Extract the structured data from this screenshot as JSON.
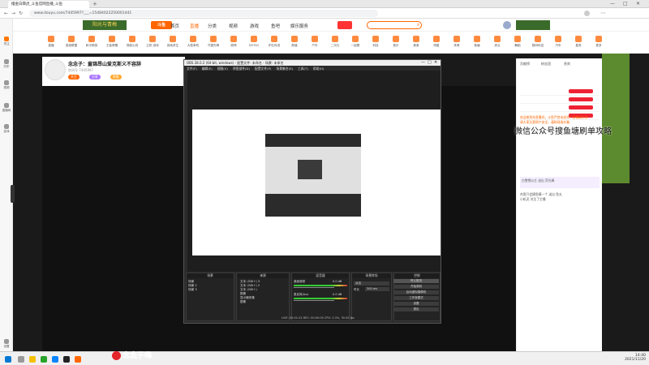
{
  "browser": {
    "tab_title": "撸金白霖虎_斗鱼官网直播_斗鱼",
    "url": "www.douyu.com/7445997?___=15484022250001441",
    "time": "14:40",
    "date": "2021/11/20"
  },
  "sidebar": {
    "items": [
      {
        "label": "关注",
        "icon": "heart-icon"
      },
      {
        "label": "历史",
        "icon": "clock-icon"
      },
      {
        "label": "视频",
        "icon": "video-icon"
      },
      {
        "label": "直播间",
        "icon": "tv-icon"
      },
      {
        "label": "游戏",
        "icon": "gamepad-icon"
      },
      {
        "label": "设置",
        "icon": "gear-icon"
      }
    ]
  },
  "topnav": {
    "logo": "斗鱼",
    "links": [
      "首页",
      "直播",
      "分类",
      "视频",
      "游戏",
      "鱼吧",
      "娱乐服务"
    ],
    "ad_text": "阳光与青梅"
  },
  "iconrow": {
    "items": [
      "直播",
      "英雄联盟",
      "和平精英",
      "王者荣耀",
      "穿越火线",
      "主机·游戏",
      "绝地求生",
      "大型单机",
      "守望先锋",
      "原神",
      "DOTA2",
      "炉石传说",
      "颜值",
      "户外",
      "二次元",
      "一起看",
      "科技",
      "音乐",
      "美食",
      "明星",
      "体育",
      "鱼塘",
      "综合",
      "舞蹈",
      "数码科技",
      "汽车",
      "星秀",
      "更多"
    ]
  },
  "stream": {
    "title": "念念子：童锦昂山爱克斯义不容辞",
    "room_no": "房间号 7445997",
    "buttons": [
      "关注",
      "分享",
      "举报"
    ],
    "anchor_name": "念念子",
    "follow_count": "关注"
  },
  "right_panel": {
    "tabs": [
      "贡献榜",
      "粉丝团",
      "贵宾"
    ],
    "chat": [
      "欢迎来到本直播间，斗鱼严禁未成年人直播或打赏",
      "请大家注意财产安全，谨防网络诈骗",
      "白雪雪公主 送出 荧光棒",
      "杰哥只会摸鱼摸一个 送出 鱼丸",
      "小机灵 关注了主播"
    ],
    "input_placeholder": "这里输入聊天内容"
  },
  "obs": {
    "title": "OBS 28.0.2 (64-bit, windows) - 配置文件: 未命名 - 场景: 未命名",
    "menu": [
      "文件(F)",
      "编辑(E)",
      "视图(V)",
      "停靠部件(D)",
      "配置文件(P)",
      "场景集合(S)",
      "工具(T)",
      "帮助(H)"
    ],
    "docks": {
      "scenes": {
        "title": "场景",
        "items": [
          "场景",
          "场景 2",
          "场景 3"
        ]
      },
      "sources": {
        "title": "来源",
        "items": [
          "文本 (GDI+) 3",
          "文本 (GDI+) 2",
          "文本 (GDI+)",
          "图像",
          "显示器采集",
          "图像"
        ]
      },
      "mixer": {
        "title": "混音器",
        "items": [
          "桌面音频",
          "麦克风/Aux"
        ],
        "levels": [
          "0.0 dB",
          "0.0 dB"
        ]
      },
      "transitions": {
        "title": "场景转场",
        "type": "淡出",
        "duration_label": "时长",
        "duration": "300 ms"
      },
      "controls": {
        "title": "控制",
        "buttons": [
          "停止推流",
          "开始录制",
          "启动虚拟摄像机",
          "工作室模式",
          "设置",
          "退出"
        ]
      }
    },
    "status": "LIVE: 00:01:24   REC: 00:00:00   CPU: 2.3%, 30.00 fps"
  },
  "danmu": "微信公众号搜鱼塘刷单攻略",
  "watermark": "念念子嗨",
  "taskbar": {
    "apps": [
      "windows-start-icon",
      "search-icon",
      "explorer-icon",
      "edge-icon",
      "wechat-icon",
      "obs-icon",
      "chrome-icon"
    ]
  },
  "colors": {
    "douyu_orange": "#ff6600",
    "obs_bg": "#2b2b2b",
    "taskbar": "#f0f0f0"
  }
}
